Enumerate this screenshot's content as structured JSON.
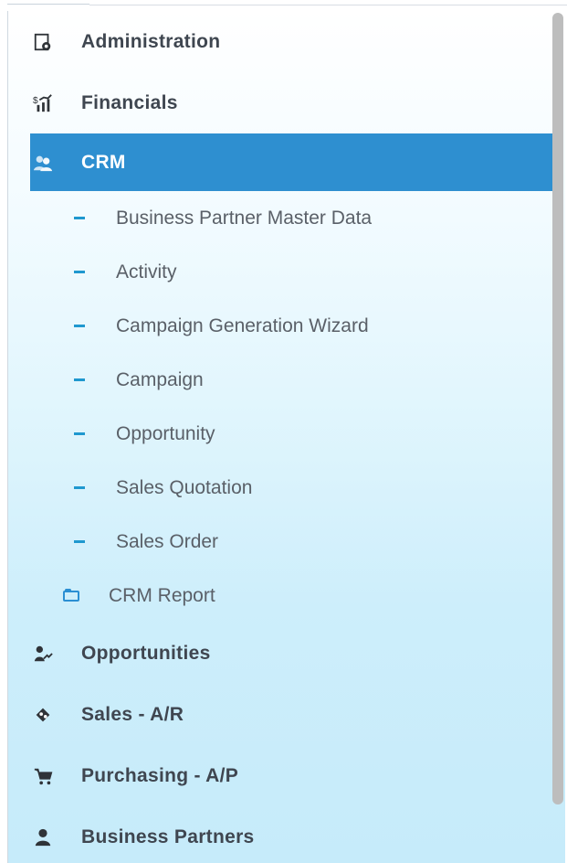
{
  "menu": {
    "items": [
      {
        "label": "Administration",
        "icon": "administration-icon",
        "active": false
      },
      {
        "label": "Financials",
        "icon": "financials-icon",
        "active": false
      },
      {
        "label": "CRM",
        "icon": "crm-icon",
        "active": true
      },
      {
        "label": "Opportunities",
        "icon": "opportunities-icon",
        "active": false
      },
      {
        "label": "Sales - A/R",
        "icon": "sales-icon",
        "active": false
      },
      {
        "label": "Purchasing - A/P",
        "icon": "cart-icon",
        "active": false
      },
      {
        "label": "Business Partners",
        "icon": "business-partners-icon",
        "active": false
      }
    ],
    "crm_subitems": [
      {
        "label": "Business Partner Master Data"
      },
      {
        "label": "Activity"
      },
      {
        "label": "Campaign Generation Wizard"
      },
      {
        "label": "Campaign"
      },
      {
        "label": "Opportunity"
      },
      {
        "label": "Sales Quotation"
      },
      {
        "label": "Sales Order"
      },
      {
        "label": "CRM Report",
        "icon": "folder-icon"
      }
    ]
  },
  "colors": {
    "active_background": "#2e8fd0",
    "sub_dash": "#1f98cf",
    "panel_gradient_start": "#ffffff",
    "panel_gradient_end": "#c6ebfa"
  }
}
